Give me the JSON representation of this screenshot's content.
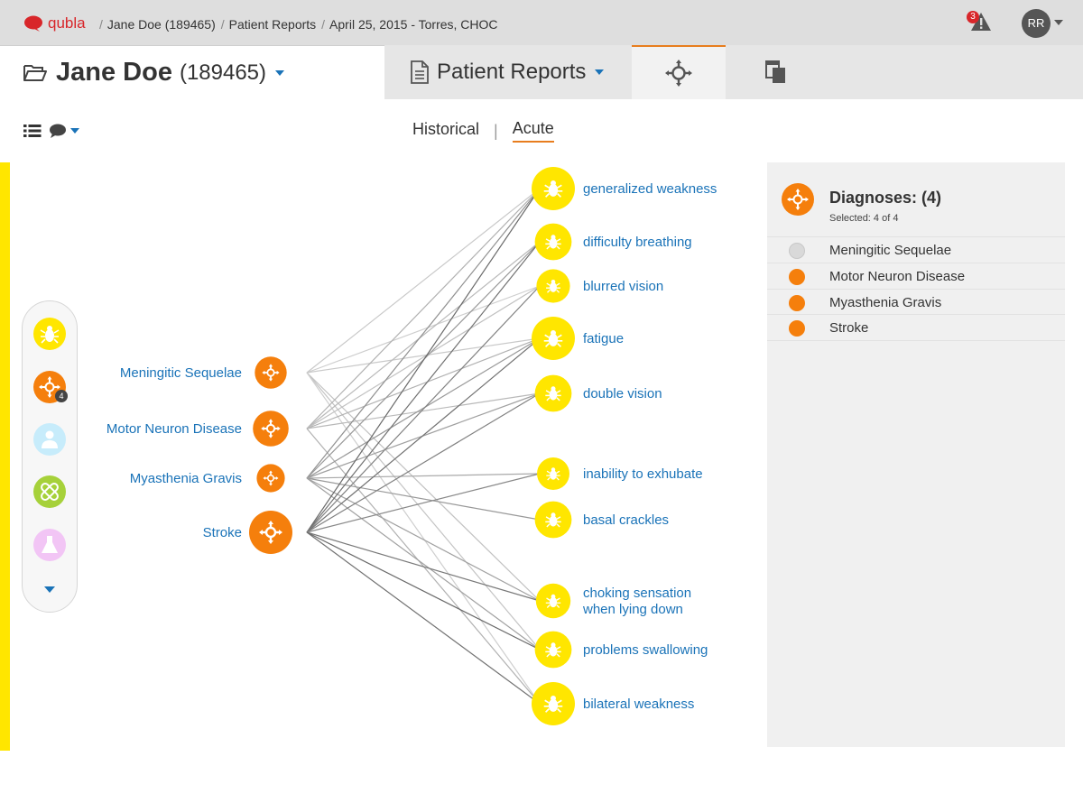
{
  "app": {
    "name": "qubla",
    "breadcrumb": [
      {
        "label": "Jane Doe (189465)"
      },
      {
        "label": "Patient Reports"
      },
      {
        "label": "April 25, 2015 - Torres, CHOC"
      }
    ],
    "alert_count": "3",
    "user_initials": "RR"
  },
  "patient": {
    "name": "Jane Doe",
    "id": "(189465)"
  },
  "tabs": {
    "reports_label": "Patient Reports"
  },
  "subtabs": {
    "historical": "Historical",
    "separator": "|",
    "acute": "Acute"
  },
  "sidebar": {
    "icons": [
      "symptom-bug-icon",
      "diagnosis-network-icon",
      "clinician-icon",
      "medication-bandage-icon",
      "lab-flask-icon"
    ],
    "diagnosis_badge": "4"
  },
  "graph": {
    "diagnoses": [
      {
        "label": "Meningitic Sequelae",
        "weight": 0.55
      },
      {
        "label": "Motor Neuron Disease",
        "weight": 0.7
      },
      {
        "label": "Myasthenia Gravis",
        "weight": 0.4
      },
      {
        "label": "Stroke",
        "weight": 1.0
      }
    ],
    "symptoms": [
      {
        "label": "generalized weakness",
        "weight": 1.0
      },
      {
        "label": "difficulty breathing",
        "weight": 0.7
      },
      {
        "label": "blurred vision",
        "weight": 0.55
      },
      {
        "label": "fatigue",
        "weight": 1.0
      },
      {
        "label": "double vision",
        "weight": 0.7
      },
      {
        "label": "inability to exhubate",
        "weight": 0.5
      },
      {
        "label": "basal crackles",
        "weight": 0.7
      },
      {
        "label": "choking sensation when lying down",
        "lines": [
          "choking sensation",
          "when lying down"
        ],
        "weight": 0.6
      },
      {
        "label": "problems swallowing",
        "weight": 0.7
      },
      {
        "label": "bilateral weakness",
        "weight": 1.0
      }
    ],
    "links": [
      [
        0,
        0,
        0.15
      ],
      [
        0,
        2,
        0.12
      ],
      [
        0,
        3,
        0.15
      ],
      [
        0,
        7,
        0.2
      ],
      [
        0,
        8,
        0.18
      ],
      [
        0,
        9,
        0.12
      ],
      [
        1,
        0,
        0.3
      ],
      [
        1,
        1,
        0.25
      ],
      [
        1,
        2,
        0.2
      ],
      [
        1,
        3,
        0.3
      ],
      [
        1,
        4,
        0.25
      ],
      [
        1,
        9,
        0.3
      ],
      [
        2,
        0,
        0.5
      ],
      [
        2,
        1,
        0.45
      ],
      [
        2,
        3,
        0.45
      ],
      [
        2,
        4,
        0.4
      ],
      [
        2,
        5,
        0.35
      ],
      [
        2,
        6,
        0.45
      ],
      [
        2,
        7,
        0.4
      ],
      [
        2,
        8,
        0.4
      ],
      [
        3,
        0,
        0.75
      ],
      [
        3,
        1,
        0.7
      ],
      [
        3,
        2,
        0.6
      ],
      [
        3,
        3,
        0.7
      ],
      [
        3,
        4,
        0.6
      ],
      [
        3,
        5,
        0.55
      ],
      [
        3,
        7,
        0.65
      ],
      [
        3,
        8,
        0.75
      ],
      [
        3,
        9,
        0.7
      ]
    ]
  },
  "panel": {
    "title": "Diagnoses: (4)",
    "subtitle": "Selected: 4 of 4",
    "items": [
      {
        "label": "Meningitic Sequelae",
        "selected": false
      },
      {
        "label": "Motor Neuron Disease",
        "selected": true
      },
      {
        "label": "Myasthenia Gravis",
        "selected": true
      },
      {
        "label": "Stroke",
        "selected": true
      }
    ]
  },
  "colors": {
    "brand": "#d8262a",
    "accent": "#e87d1e",
    "diagnosis": "#f57f0c",
    "symptom": "#ffe600",
    "link": "#1a73b8",
    "unselected": "#d9d9d9"
  }
}
